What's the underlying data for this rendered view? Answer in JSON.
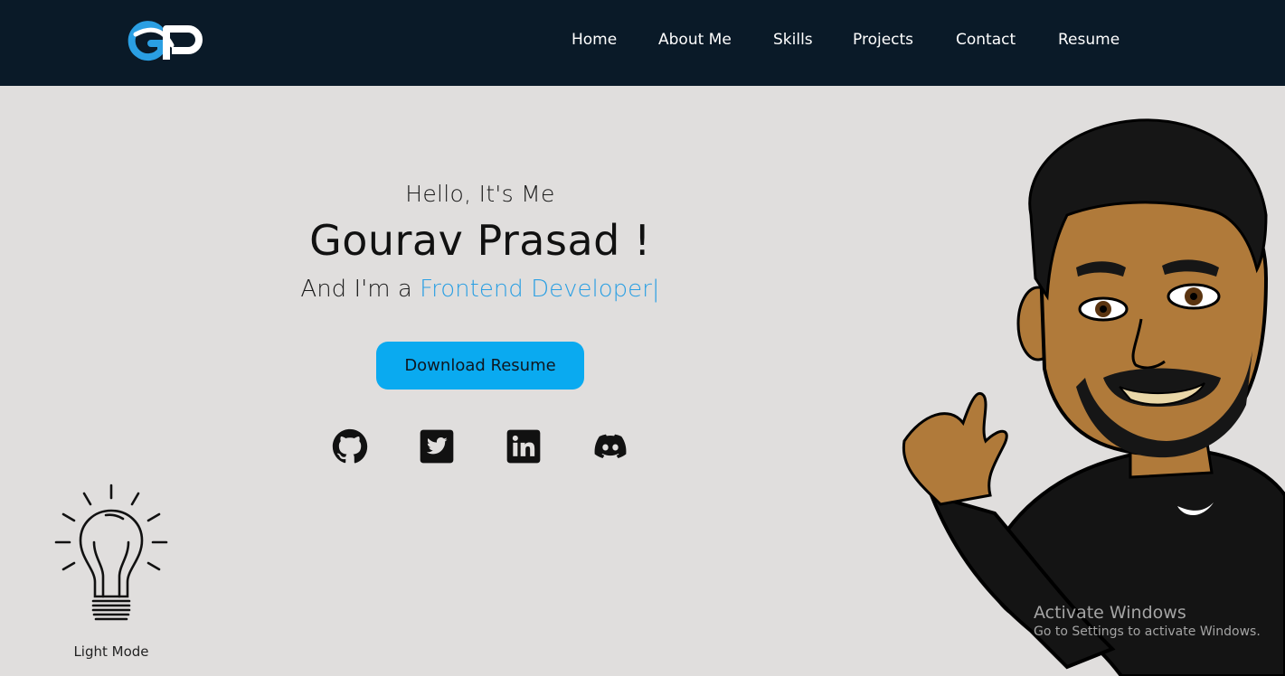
{
  "logo": {
    "text": "GP",
    "icon": "gp-logo"
  },
  "nav": {
    "items": [
      {
        "label": "Home"
      },
      {
        "label": "About Me"
      },
      {
        "label": "Skills"
      },
      {
        "label": "Projects"
      },
      {
        "label": "Contact"
      },
      {
        "label": "Resume"
      }
    ]
  },
  "hero": {
    "greeting": "Hello, It's Me",
    "name": "Gourav Prasad !",
    "role_prefix": "And I'm a",
    "role_highlight": "Frontend Developer",
    "cursor": "|",
    "download_label": "Download Resume"
  },
  "social": [
    {
      "icon": "github-icon"
    },
    {
      "icon": "twitter-icon"
    },
    {
      "icon": "linkedin-icon"
    },
    {
      "icon": "discord-icon"
    }
  ],
  "mode_toggle": {
    "label": "Light Mode",
    "icon": "lightbulb-icon"
  },
  "avatar": {
    "icon": "waving-avatar"
  },
  "watermark": {
    "title": "Activate Windows",
    "subtitle": "Go to Settings to activate Windows."
  },
  "colors": {
    "navbar": "#0a1a28",
    "background": "#e0dedd",
    "accent": "#2a9fe3",
    "button": "#0aaaf0"
  }
}
